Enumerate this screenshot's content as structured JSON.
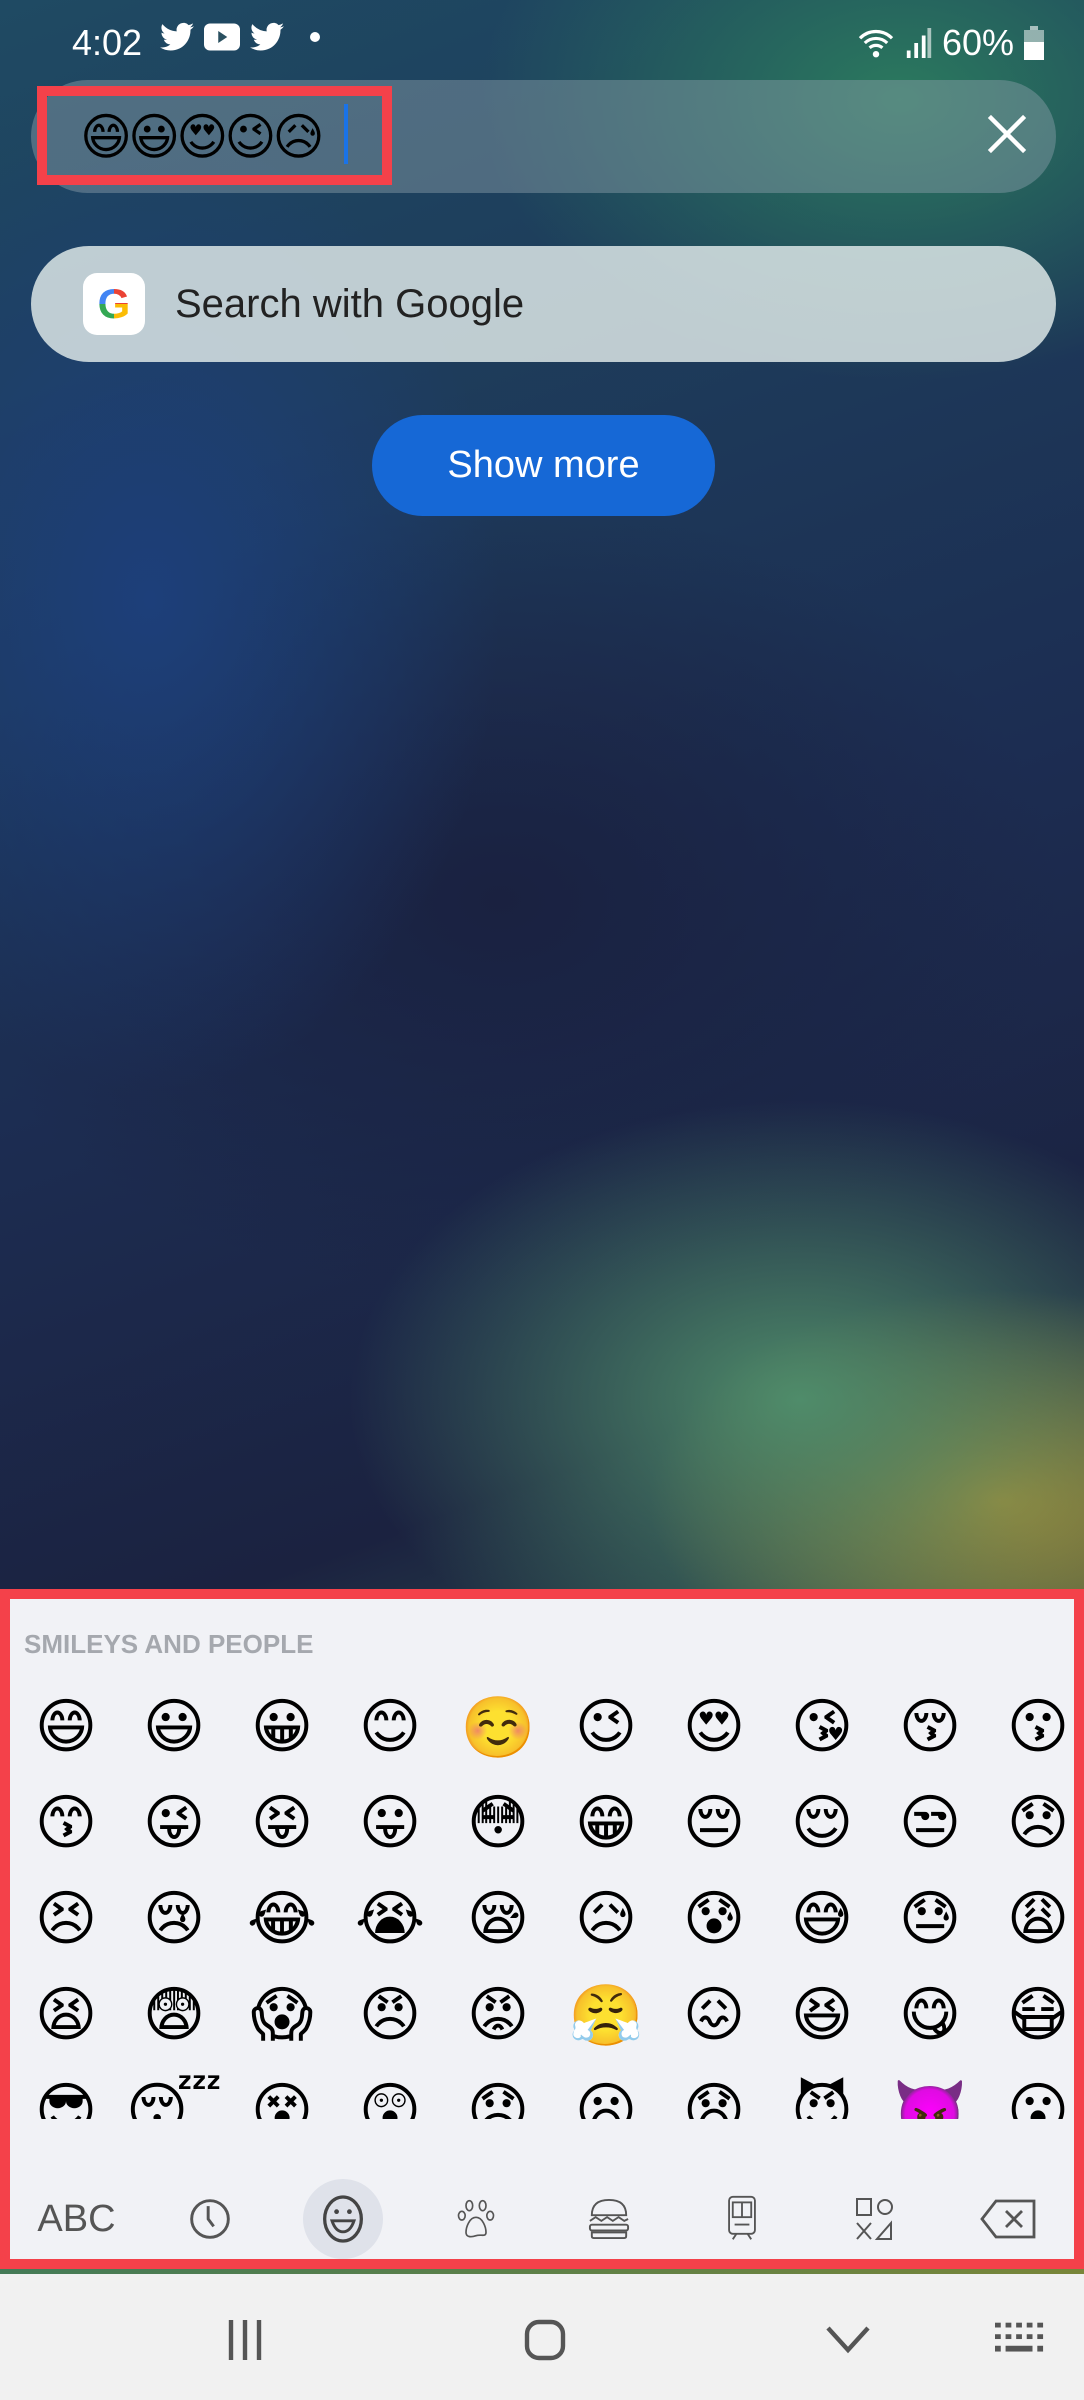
{
  "status_bar": {
    "time": "4:02",
    "battery": "60%",
    "notification_icons": [
      "twitter-icon",
      "youtube-icon",
      "twitter-icon",
      "dot-icon"
    ],
    "system_icons": [
      "wifi-icon",
      "signal-icon",
      "battery-icon"
    ]
  },
  "search": {
    "query": "😄😃😍😉😥",
    "clear_icon": "close-icon"
  },
  "google_search": {
    "label": "Search with Google",
    "logo": "G"
  },
  "show_more": {
    "label": "Show more"
  },
  "keyboard": {
    "section_title": "SMILEYS AND PEOPLE",
    "emojis": [
      "😄",
      "😃",
      "😀",
      "😊",
      "☺️",
      "😉",
      "😍",
      "😘",
      "😚",
      "😗",
      "😙",
      "😜",
      "😝",
      "😛",
      "😳",
      "😁",
      "😔",
      "😌",
      "😒",
      "😞",
      "😣",
      "😢",
      "😂",
      "😭",
      "😪",
      "😥",
      "😰",
      "😅",
      "😓",
      "😩",
      "😫",
      "😨",
      "😱",
      "😠",
      "😡",
      "😤",
      "😖",
      "😆",
      "😋",
      "😷",
      "😎",
      "😴",
      "😵",
      "😲",
      "😟",
      "😦",
      "😧",
      "😈",
      "👿",
      "😮",
      "😬",
      "😐",
      "😕",
      "😯",
      "😶",
      "😇",
      "😏",
      "😑",
      "👲",
      "👳"
    ],
    "abc_label": "ABC",
    "tabs": [
      "recent-icon",
      "smiley-icon",
      "paw-icon",
      "burger-icon",
      "train-icon",
      "symbols-icon",
      "backspace-icon"
    ],
    "selected_tab": "smiley-icon"
  },
  "nav_bar": {
    "buttons": [
      "recents",
      "home",
      "back",
      "keyboard-switch"
    ]
  },
  "highlight_color": "#f4414a",
  "accent_color": "#1668d6"
}
